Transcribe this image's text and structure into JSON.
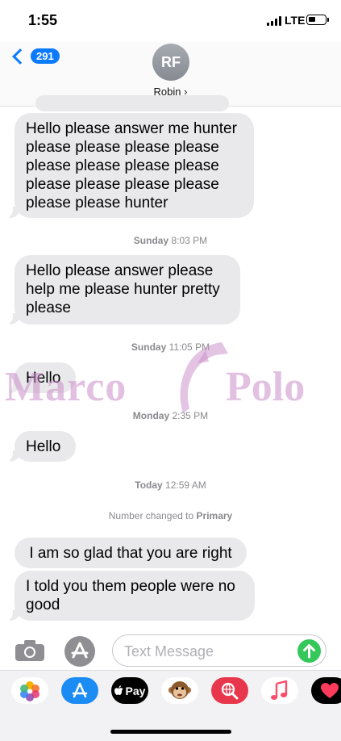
{
  "status_bar": {
    "time": "1:55",
    "network": "LTE",
    "battery_level": 0.45
  },
  "header": {
    "back_badge": "291",
    "avatar_initials": "RF",
    "contact_name": "Robin ›"
  },
  "messages": [
    {
      "text": "Hello please answer me hunter please please please please please please please please please please please please please please hunter"
    },
    {
      "text": "Hello please answer please help me please hunter pretty please"
    },
    {
      "text": "Hello"
    },
    {
      "text": "Hello"
    },
    {
      "text": "I am so glad that you are right"
    },
    {
      "text": "I told you them people were no good"
    }
  ],
  "timestamps": [
    {
      "day": "Sunday",
      "time": "8:03 PM"
    },
    {
      "day": "Sunday",
      "time": "11:05 PM"
    },
    {
      "day": "Monday",
      "time": "2:35 PM"
    },
    {
      "day": "Today",
      "time": "12:59 AM"
    }
  ],
  "notice": {
    "prefix": "Number changed to",
    "target": "Primary"
  },
  "watermark": {
    "left": "Marco",
    "right": "Polo"
  },
  "input": {
    "placeholder": "Text Message"
  },
  "apps": [
    {
      "name": "Photos",
      "icon": "photos-icon"
    },
    {
      "name": "App Store",
      "icon": "app-store-icon"
    },
    {
      "name": "Pay",
      "label": "Pay",
      "icon": "apple-pay-icon"
    },
    {
      "name": "Animoji",
      "icon": "monkey-icon"
    },
    {
      "name": "Search",
      "icon": "globe-search-icon"
    },
    {
      "name": "Music",
      "icon": "music-note-icon"
    },
    {
      "name": "Digital Touch",
      "icon": "heart-icon"
    }
  ],
  "colors": {
    "accent": "#0a7aff",
    "bubble": "#e9e9eb",
    "send": "#34c759",
    "watermark": "#c88cc8"
  }
}
